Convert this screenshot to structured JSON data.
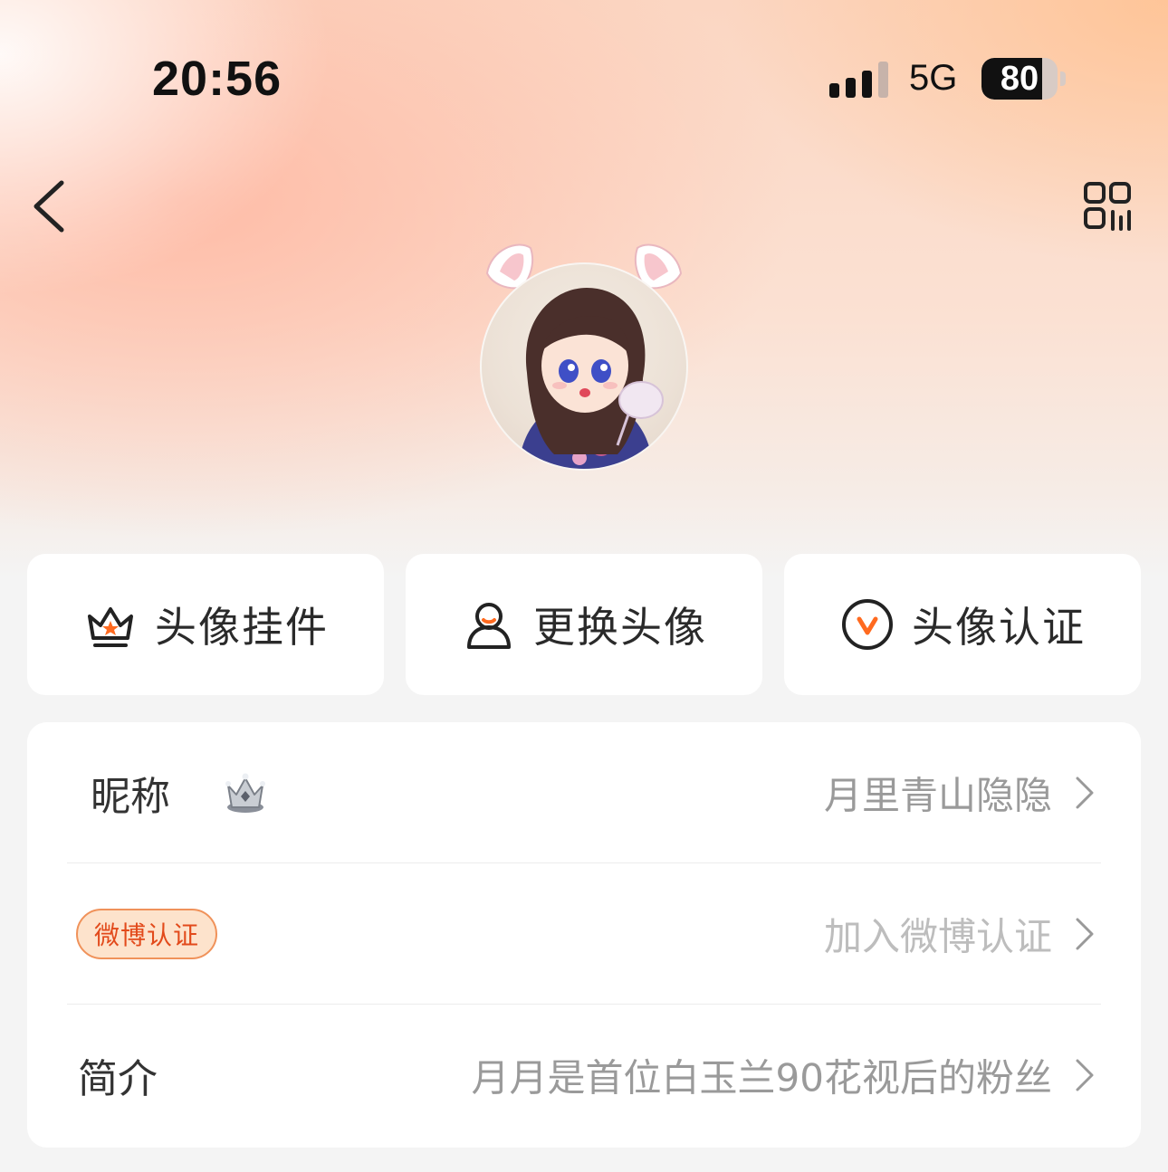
{
  "status_bar": {
    "time": "20:56",
    "network": "5G",
    "battery_level": "80",
    "battery_fraction": 0.8,
    "signal_bars_active": 3,
    "signal_bars_total": 4
  },
  "header": {
    "back_icon": "chevron-left-icon",
    "qr_icon": "qr-code-icon"
  },
  "avatar": {
    "description_icon": "avatar-illustration"
  },
  "actions": [
    {
      "label": "头像挂件",
      "icon": "crown-icon"
    },
    {
      "label": "更换头像",
      "icon": "person-icon"
    },
    {
      "label": "头像认证",
      "icon": "verified-v-icon"
    }
  ],
  "profile": {
    "nickname": {
      "label": "昵称",
      "value": "月里青山隐隐",
      "badge_icon": "crown-badge-icon"
    },
    "verification": {
      "badge": "微博认证",
      "value": "加入微博认证"
    },
    "bio": {
      "label": "简介",
      "value": "月月是首位白玉兰90花视后的粉丝"
    }
  },
  "colors": {
    "accent": "#ff6a1f",
    "verify_badge_bg": "#fde3cc",
    "verify_badge_text": "#e24a1b"
  }
}
